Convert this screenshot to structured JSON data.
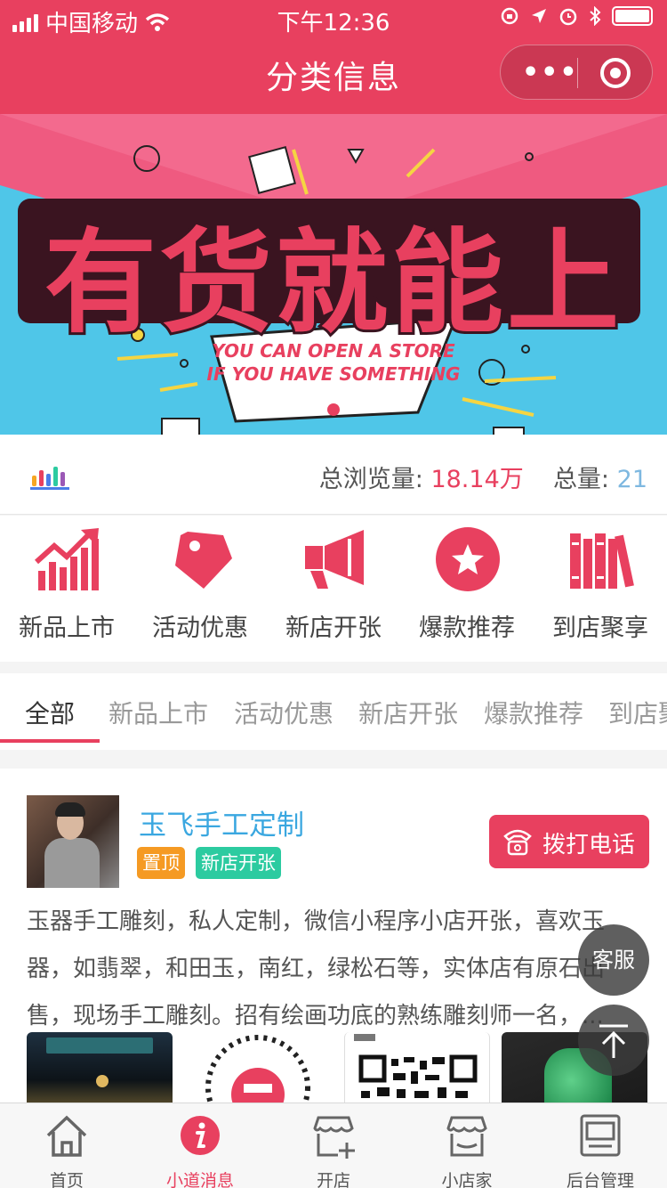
{
  "status_bar": {
    "carrier": "中国移动",
    "time": "下午12:36"
  },
  "navbar": {
    "title": "分类信息"
  },
  "banner": {
    "headline": "有货就能上",
    "subtitle_line1": "YOU CAN OPEN A STORE",
    "subtitle_line2": "IF YOU HAVE SOMETHING"
  },
  "stats": {
    "views_label": "总浏览量:",
    "views_value": "18.14万",
    "total_label": "总量:",
    "total_value": "21"
  },
  "categories": [
    {
      "label": "新品上市",
      "icon": "trend-chart-icon"
    },
    {
      "label": "活动优惠",
      "icon": "price-tag-icon"
    },
    {
      "label": "新店开张",
      "icon": "megaphone-icon"
    },
    {
      "label": "爆款推荐",
      "icon": "star-icon"
    },
    {
      "label": "到店聚享",
      "icon": "books-icon"
    }
  ],
  "tabs": [
    "全部",
    "新品上市",
    "活动优惠",
    "新店开张",
    "爆款推荐",
    "到店聚享"
  ],
  "post": {
    "shop_name": "玉飞手工定制",
    "tag_top": "置顶",
    "tag_category": "新店开张",
    "call_label": "拨打电话",
    "description": "玉器手工雕刻，私人定制，微信小程序小店开张，喜欢玉器，如翡翠，和田玉，南红，绿松石等，实体店有原石出售，现场手工雕刻。招有绘画功底的熟练雕刻师一名，..."
  },
  "floating": {
    "service_label": "客服"
  },
  "tabbar": [
    {
      "label": "首页",
      "icon": "home-icon"
    },
    {
      "label": "小道消息",
      "icon": "info-icon"
    },
    {
      "label": "开店",
      "icon": "open-store-icon"
    },
    {
      "label": "小店家",
      "icon": "shop-icon"
    },
    {
      "label": "后台管理",
      "icon": "admin-icon"
    }
  ],
  "colors": {
    "brand": "#e8405f",
    "banner_blue": "#4fc6e8",
    "link_blue": "#3aa7e0",
    "tag_orange": "#f59a23",
    "tag_green": "#2ccba0"
  }
}
